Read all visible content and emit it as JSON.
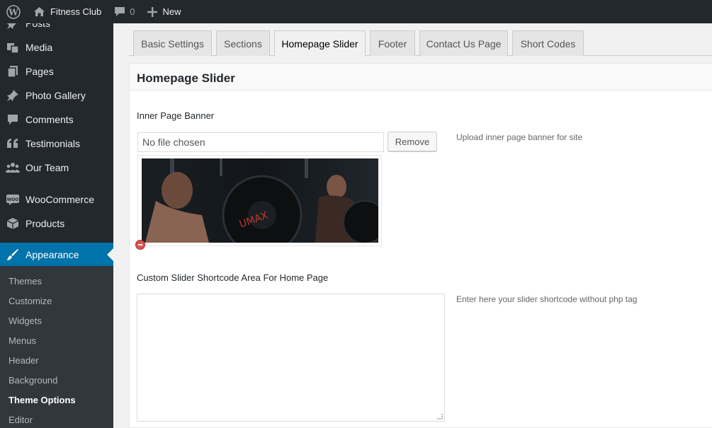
{
  "admin_bar": {
    "site_name": "Fitness Club",
    "comments_count": "0",
    "new_label": "New"
  },
  "sidebar": {
    "items": [
      {
        "label": "Posts",
        "icon": "pin-icon"
      },
      {
        "label": "Media",
        "icon": "media-icon"
      },
      {
        "label": "Pages",
        "icon": "pages-icon"
      },
      {
        "label": "Photo Gallery",
        "icon": "pin-icon"
      },
      {
        "label": "Comments",
        "icon": "comment-icon"
      },
      {
        "label": "Testimonials",
        "icon": "quote-icon"
      },
      {
        "label": "Our Team",
        "icon": "team-icon"
      },
      {
        "label": "WooCommerce",
        "icon": "woo-icon"
      },
      {
        "label": "Products",
        "icon": "box-icon"
      },
      {
        "label": "Appearance",
        "icon": "brush-icon"
      }
    ],
    "submenu": [
      "Themes",
      "Customize",
      "Widgets",
      "Menus",
      "Header",
      "Background",
      "Theme Options",
      "Editor"
    ],
    "active_submenu": "Theme Options"
  },
  "tabs": [
    "Basic Settings",
    "Sections",
    "Homepage Slider",
    "Footer",
    "Contact Us Page",
    "Short Codes"
  ],
  "active_tab": "Homepage Slider",
  "panel": {
    "title": "Homepage Slider",
    "banner": {
      "label": "Inner Page Banner",
      "file_value": "No file chosen",
      "remove_label": "Remove",
      "description": "Upload inner page banner for site"
    },
    "shortcode": {
      "label": "Custom Slider Shortcode Area For Home Page",
      "value": "",
      "description": "Enter here your slider shortcode without php tag"
    }
  },
  "colors": {
    "admin_bg": "#23282d",
    "accent": "#0073aa",
    "submenu_bg": "#32373c"
  }
}
